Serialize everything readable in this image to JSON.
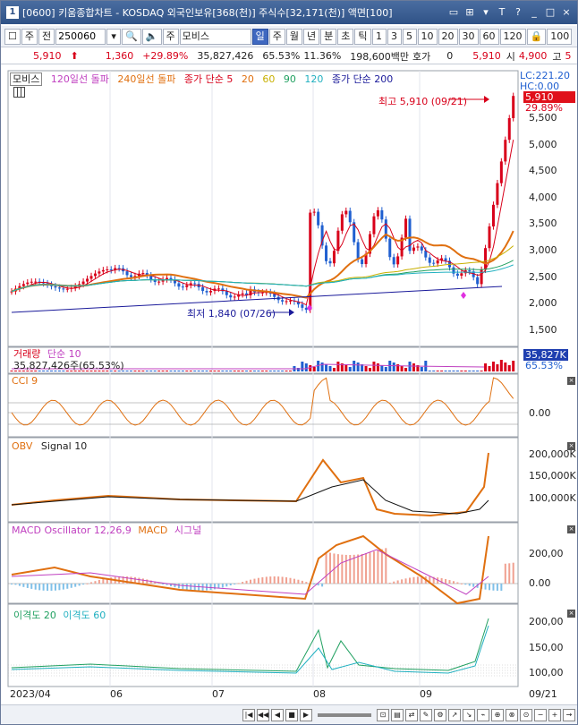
{
  "window": {
    "number_badge": "1",
    "title": "[0600] 키움종합차트 - KOSDAQ 외국인보유[368(천)] 주식수[32,171(천)] 액면[100]",
    "controls": [
      "▭",
      "⊞",
      "▾",
      "T",
      "?",
      "_",
      "□",
      "×"
    ]
  },
  "toolbar": {
    "period_type": "주",
    "adjust": "전",
    "stock_code": "250060",
    "stock_name": "모비스",
    "stock_prefix": "주",
    "intervals": [
      "일",
      "주",
      "월",
      "년",
      "분",
      "초",
      "틱"
    ],
    "active_interval": "일",
    "minute_presets": [
      "1",
      "3",
      "5",
      "10",
      "20",
      "30",
      "60",
      "120"
    ],
    "count": "100"
  },
  "quote": {
    "price": "5,910",
    "change": "1,360",
    "change_pct": "+29.89%",
    "volume": "35,827,426",
    "volume_ratio": "65.53%",
    "turnover": "11.36%",
    "amount": "198,600백만",
    "hoga_label": "호가",
    "hoga_value": "0",
    "hoga_price": "5,910",
    "open_label": "시",
    "open_value": "4,900",
    "high_label": "고",
    "high_value_partial": "5"
  },
  "price_pane": {
    "legend": [
      {
        "text": "모비스",
        "color": "#222222"
      },
      {
        "text": "120일선 돌파",
        "color": "#c040c0"
      },
      {
        "text": "240일선 돌파",
        "color": "#e07010"
      },
      {
        "text": "종가 단순 5",
        "color": "#d8001a"
      },
      {
        "text": "20",
        "color": "#e07010"
      },
      {
        "text": "60",
        "color": "#c8b000"
      },
      {
        "text": "90",
        "color": "#20a060"
      },
      {
        "text": "120",
        "color": "#20b0c0"
      },
      {
        "text": "종가 단순 200",
        "color": "#1a1a9a"
      }
    ],
    "lc_label": "LC:221.20",
    "hc_label": "HC:0.00",
    "current_price_tag": "5,910",
    "current_pct_tag": "29.89%",
    "high_annotation": "최고 5,910 (09/21)",
    "low_annotation": "최저 1,840 (07/26)",
    "y_ticks": [
      "5,500",
      "5,000",
      "4,500",
      "4,000",
      "3,500",
      "3,000",
      "2,500",
      "2,000",
      "1,500"
    ]
  },
  "volume_pane": {
    "legend_name": "거래량",
    "legend_ma": "단순 10",
    "value_text": "35,827,426주(65.53%)",
    "tag_value": "35,827K",
    "tag_pct": "65.53%"
  },
  "cci_pane": {
    "legend": "CCI 9",
    "y_tick": "0.00"
  },
  "obv_pane": {
    "legend": "OBV",
    "signal": "Signal 10",
    "y_ticks": [
      "200,000K",
      "150,000K",
      "100,000K"
    ]
  },
  "macd_pane": {
    "legend": "MACD Oscillator 12,26,9",
    "macd": "MACD",
    "signal": "시그널",
    "y_ticks": [
      "200,00",
      "0.00"
    ]
  },
  "disparity_pane": {
    "legend1": "이격도 20",
    "legend2": "이격도 60",
    "y_ticks": [
      "200,00",
      "150,00",
      "100,00"
    ]
  },
  "x_axis": [
    "2023/04",
    "06",
    "07",
    "08",
    "09",
    "09/21"
  ],
  "colors": {
    "up": "#d8001a",
    "down": "#1f5fd0",
    "accent": "#3f68c0"
  }
}
